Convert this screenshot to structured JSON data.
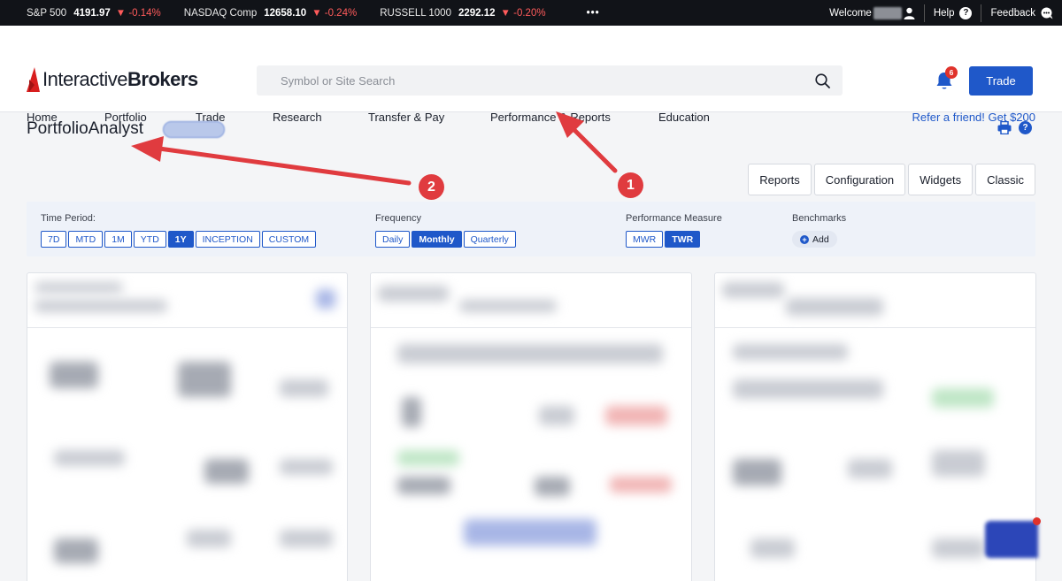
{
  "ticker": [
    {
      "name": "S&P 500",
      "value": "4191.97",
      "change": "-0.14%"
    },
    {
      "name": "NASDAQ Comp",
      "value": "12658.10",
      "change": "-0.24%"
    },
    {
      "name": "RUSSELL 1000",
      "value": "2292.12",
      "change": "-0.20%"
    }
  ],
  "ticker_more": "•••",
  "topbar": {
    "welcome": "Welcome",
    "help": "Help",
    "feedback": "Feedback"
  },
  "logo": {
    "part1": "Interactive",
    "part2": "Brokers"
  },
  "search": {
    "placeholder": "Symbol or Site Search"
  },
  "notifications": {
    "count": "6"
  },
  "trade_button": "Trade",
  "nav": [
    "Home",
    "Portfolio",
    "Trade",
    "Research",
    "Transfer & Pay",
    "Performance & Reports",
    "Education"
  ],
  "refer": "Refer a friend! Get $200",
  "page_title": "PortfolioAnalyst",
  "view_tabs": [
    "Reports",
    "Configuration",
    "Widgets",
    "Classic"
  ],
  "filters": {
    "time_period": {
      "label": "Time Period:",
      "options": [
        "7D",
        "MTD",
        "1M",
        "YTD",
        "1Y",
        "INCEPTION",
        "CUSTOM"
      ],
      "selected": "1Y"
    },
    "frequency": {
      "label": "Frequency",
      "options": [
        "Daily",
        "Monthly",
        "Quarterly"
      ],
      "selected": "Monthly"
    },
    "measure": {
      "label": "Performance Measure",
      "options": [
        "MWR",
        "TWR"
      ],
      "selected": "TWR"
    },
    "benchmarks": {
      "label": "Benchmarks",
      "add": "Add"
    }
  },
  "annotations": {
    "one": "1",
    "two": "2"
  },
  "colors": {
    "accent": "#1f58c9",
    "negative": "#ff5b5b",
    "annotation": "#e03b3f"
  }
}
